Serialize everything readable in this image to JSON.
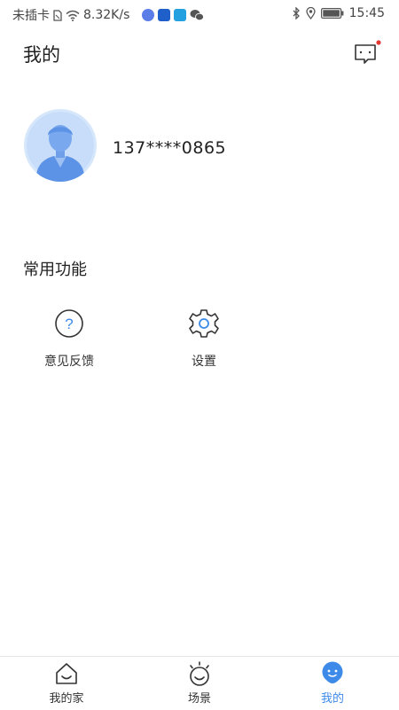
{
  "status_bar": {
    "carrier": "未插卡",
    "speed": "8.32K/s",
    "time": "15:45"
  },
  "header": {
    "title": "我的",
    "has_unread": true
  },
  "profile": {
    "phone": "137****0865"
  },
  "common_functions": {
    "title": "常用功能",
    "items": [
      {
        "label": "意见反馈",
        "icon": "question-icon"
      },
      {
        "label": "设置",
        "icon": "gear-icon"
      }
    ]
  },
  "tab_bar": {
    "items": [
      {
        "label": "我的家",
        "icon": "home-face-icon",
        "active": false
      },
      {
        "label": "场景",
        "icon": "sun-face-icon",
        "active": false
      },
      {
        "label": "我的",
        "icon": "mascot-icon",
        "active": true
      }
    ]
  },
  "colors": {
    "accent": "#3d8ae8",
    "avatar_bg": "#d7e7fb",
    "badge": "#e53935"
  }
}
